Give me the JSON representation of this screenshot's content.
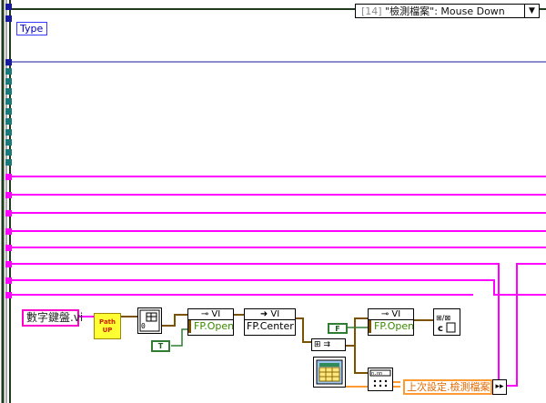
{
  "event_selector": {
    "index": "[14]",
    "label": "\"檢測檔案\": Mouse Down",
    "arrow": "▼"
  },
  "type_node": {
    "label": "Type"
  },
  "path_constant": {
    "value": "數字鍵盤.vi"
  },
  "path_up": {
    "line1": "Path",
    "line2": "UP"
  },
  "nodes": [
    {
      "id": "open1",
      "head": "VI",
      "body": "FP.Open"
    },
    {
      "id": "center",
      "head": "VI",
      "body": "FP.Center"
    },
    {
      "id": "open2",
      "head": "VI",
      "body": "FP.Open"
    }
  ],
  "bool_constants": [
    {
      "value": "T"
    },
    {
      "value": "F"
    }
  ],
  "output_indicator": {
    "label": "上次設定.檢測檔案"
  },
  "colors": {
    "wire_pink": "#ff00ff",
    "wire_blue": "#1a1aa0",
    "frame_dark": "#1f3a1f",
    "terminal_teal": "#1a7a7a",
    "node_green": "#2e7d32",
    "string_orange": "#ff9a33",
    "refnum_brown": "#7a5200"
  },
  "icons": [
    "path-strip-icon",
    "vi-refnum-icon",
    "table-control-icon",
    "array-format-icon",
    "close-reference-icon"
  ]
}
